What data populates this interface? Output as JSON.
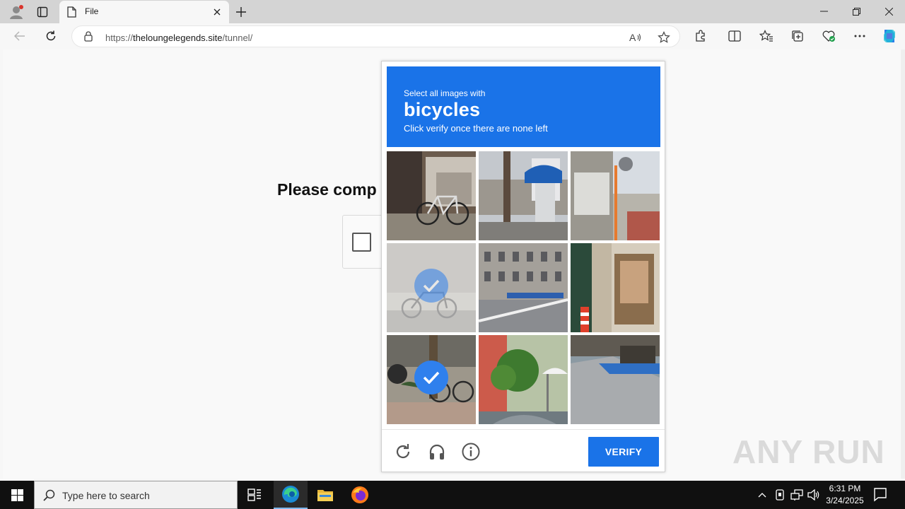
{
  "browser": {
    "tab_title": "File",
    "url_host": "theloungelegends.site",
    "url_prefix": "https://",
    "url_path": "/tunnel/"
  },
  "page": {
    "heading": "Please comp"
  },
  "captcha": {
    "subtitle": "Select all images with",
    "target_word": "bicycles",
    "instruction": "Click verify once there are none left",
    "verify_label": "VERIFY",
    "tiles": [
      {
        "scene": "bicycle parked by shop",
        "selected": false
      },
      {
        "scene": "street with tree and blue awning",
        "selected": false
      },
      {
        "scene": "narrow street with sign",
        "selected": false
      },
      {
        "scene": "bicycle by pole (faded)",
        "selected": true
      },
      {
        "scene": "building with parked bikes",
        "selected": false
      },
      {
        "scene": "shop entrance with cone",
        "selected": false
      },
      {
        "scene": "motorcycle and bicycle",
        "selected": true
      },
      {
        "scene": "shrubs and parasol",
        "selected": false
      },
      {
        "scene": "street with blue pavement",
        "selected": false
      }
    ],
    "accent": "#1a73e8"
  },
  "watermark": "ANY RUN",
  "taskbar": {
    "search_placeholder": "Type here to search",
    "time": "6:31 PM",
    "date": "3/24/2025"
  }
}
